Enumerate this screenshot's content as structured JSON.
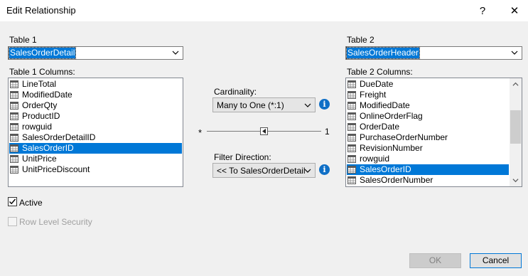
{
  "window": {
    "title": "Edit Relationship",
    "help_glyph": "?",
    "close_glyph": "✕"
  },
  "table1": {
    "label": "Table 1",
    "selected": "SalesOrderDetail",
    "columns_label": "Table 1 Columns:",
    "columns": [
      "LineTotal",
      "ModifiedDate",
      "OrderQty",
      "ProductID",
      "rowguid",
      "SalesOrderDetailID",
      "SalesOrderID",
      "UnitPrice",
      "UnitPriceDiscount"
    ],
    "selected_column": "SalesOrderID"
  },
  "table2": {
    "label": "Table 2",
    "selected": "SalesOrderHeader",
    "columns_label": "Table 2 Columns:",
    "columns": [
      "DueDate",
      "Freight",
      "ModifiedDate",
      "OnlineOrderFlag",
      "OrderDate",
      "PurchaseOrderNumber",
      "RevisionNumber",
      "rowguid",
      "SalesOrderID",
      "SalesOrderNumber"
    ],
    "selected_column": "SalesOrderID"
  },
  "cardinality": {
    "label": "Cardinality:",
    "value": "Many to One (*:1)",
    "left_symbol": "*",
    "right_symbol": "1"
  },
  "filter_direction": {
    "label": "Filter Direction:",
    "value": "<< To SalesOrderDetail"
  },
  "options": {
    "active_label": "Active",
    "active_checked": true,
    "rls_label": "Row Level Security",
    "rls_checked": false
  },
  "buttons": {
    "ok": "OK",
    "cancel": "Cancel"
  },
  "icons": {
    "info": "i",
    "table": "table-icon",
    "chevron": "chevron-down-icon"
  },
  "colors": {
    "selection": "#0078d7",
    "info": "#0f6fc6"
  }
}
